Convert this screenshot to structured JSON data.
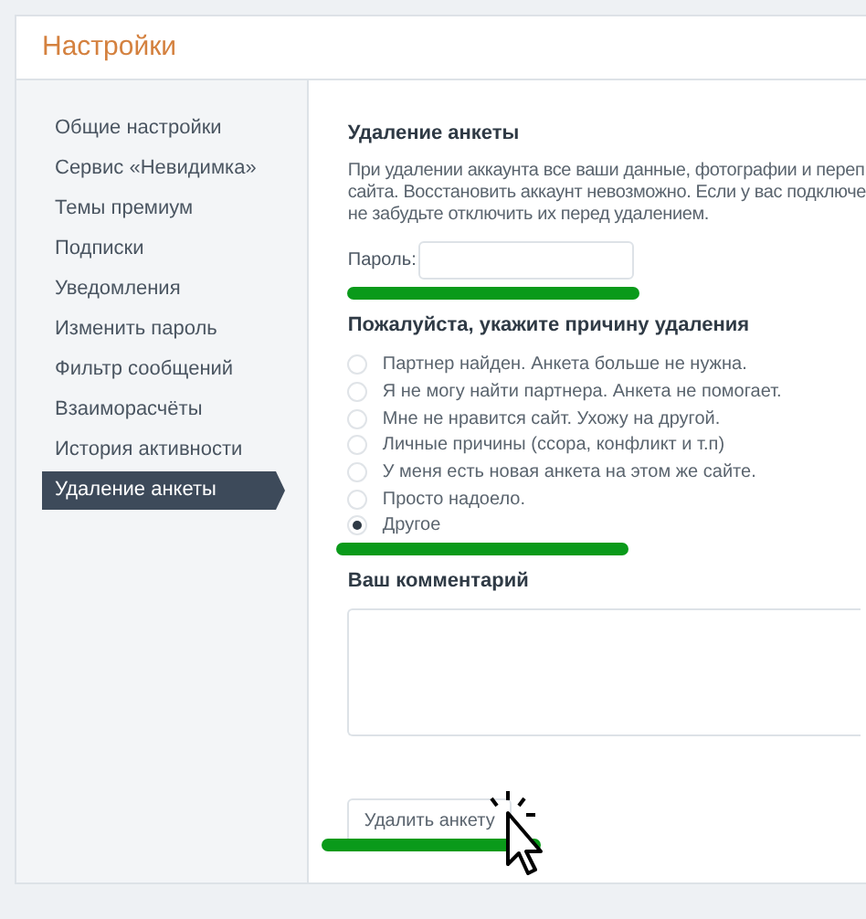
{
  "header": {
    "title": "Настройки"
  },
  "sidebar": {
    "items": [
      {
        "label": "Общие настройки",
        "selected": false
      },
      {
        "label": "Сервис «Невидимка»",
        "selected": false
      },
      {
        "label": "Темы премиум",
        "selected": false
      },
      {
        "label": "Подписки",
        "selected": false
      },
      {
        "label": "Уведомления",
        "selected": false
      },
      {
        "label": "Изменить пароль",
        "selected": false
      },
      {
        "label": "Фильтр сообщений",
        "selected": false
      },
      {
        "label": "Взаиморасчёты",
        "selected": false
      },
      {
        "label": "История активности",
        "selected": false
      },
      {
        "label": "Удаление анкеты",
        "selected": true
      }
    ]
  },
  "main": {
    "heading": "Удаление анкеты",
    "description_lines": [
      "При удалении аккаунта все ваши данные, фотографии и переп",
      "сайта. Восстановить аккаунт невозможно. Если у вас подключе",
      "не забудьте отключить их перед удалением."
    ],
    "password": {
      "label": "Пароль:"
    },
    "reason_heading": "Пожалуйста, укажите причину удаления",
    "reasons": [
      {
        "label": "Партнер найден. Анкета больше не нужна.",
        "selected": false
      },
      {
        "label": "Я не могу найти партнера. Анкета не помогает.",
        "selected": false
      },
      {
        "label": "Мне не нравится сайт. Ухожу на другой.",
        "selected": false
      },
      {
        "label": "Личные причины (ссора, конфликт и т.п)",
        "selected": false
      },
      {
        "label": "У меня есть новая анкета на этом же сайте.",
        "selected": false
      },
      {
        "label": "Просто надоело.",
        "selected": false
      },
      {
        "label": "Другое",
        "selected": true
      }
    ],
    "comment_heading": "Ваш комментарий",
    "delete_button": "Удалить анкету"
  }
}
